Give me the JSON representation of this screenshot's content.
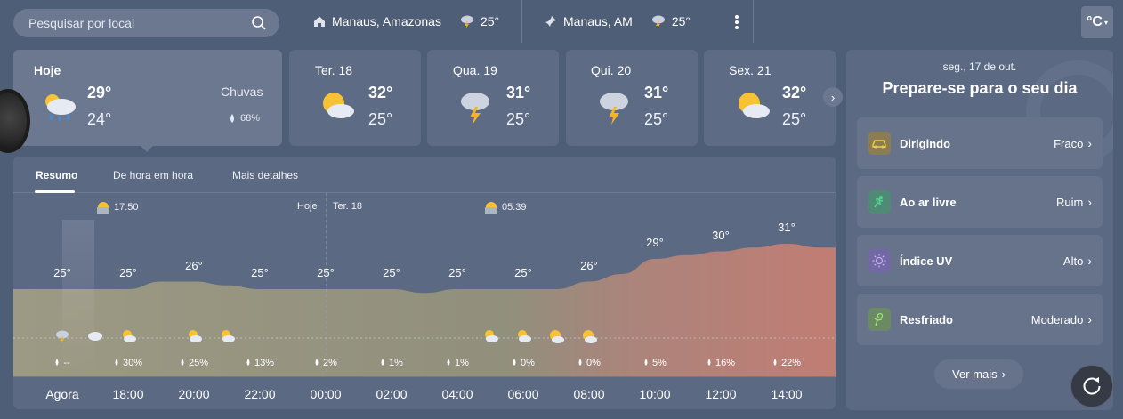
{
  "search": {
    "placeholder": "Pesquisar por local"
  },
  "locations": [
    {
      "name": "Manaus, Amazonas",
      "temp": "25°",
      "icon": "home-icon"
    },
    {
      "name": "Manaus, AM",
      "temp": "25°",
      "icon": "pin-icon"
    }
  ],
  "unit": {
    "label": "°C"
  },
  "forecast": [
    {
      "day": "Hoje",
      "hi": "29°",
      "lo": "24°",
      "icon": "rain-cloud-icon",
      "rain_label": "Chuvas",
      "rain_pct": "68%"
    },
    {
      "day": "Ter. 18",
      "hi": "32°",
      "lo": "25°",
      "icon": "partly-cloudy-icon"
    },
    {
      "day": "Qua. 19",
      "hi": "31°",
      "lo": "25°",
      "icon": "thunderstorm-icon"
    },
    {
      "day": "Qui. 20",
      "hi": "31°",
      "lo": "25°",
      "icon": "thunderstorm-icon"
    },
    {
      "day": "Sex. 21",
      "hi": "32°",
      "lo": "25°",
      "icon": "partly-cloudy-icon"
    }
  ],
  "tabs": [
    "Resumo",
    "De hora em hora",
    "Mais detalhes"
  ],
  "markers": {
    "sunset": "17:50",
    "today": "Hoje",
    "tomorrow": "Ter. 18",
    "sunrise": "05:39"
  },
  "chart_data": {
    "type": "area",
    "x": [
      "Agora",
      "",
      "18:00",
      "",
      "20:00",
      "",
      "22:00",
      "",
      "00:00",
      "",
      "02:00",
      "",
      "04:00",
      "",
      "06:00",
      "",
      "08:00",
      "",
      "10:00",
      "",
      "12:00",
      "",
      "14:00",
      ""
    ],
    "temperature": [
      25,
      25,
      25,
      26,
      26,
      25.5,
      25,
      25,
      25,
      25,
      25,
      24.5,
      25,
      25,
      25,
      25,
      26,
      27,
      29,
      29.5,
      30,
      30.5,
      31,
      30.5
    ],
    "labels": [
      "25°",
      "25°",
      "26°",
      "25°",
      "25°",
      "25°",
      "25°",
      "25°",
      "26°",
      "29°",
      "30°",
      "31°"
    ],
    "times": [
      "Agora",
      "18:00",
      "20:00",
      "22:00",
      "00:00",
      "02:00",
      "04:00",
      "06:00",
      "08:00",
      "10:00",
      "12:00",
      "14:00"
    ],
    "precip": [
      "--",
      "30%",
      "25%",
      "13%",
      "2%",
      "1%",
      "1%",
      "0%",
      "0%",
      "5%",
      "16%",
      "22%"
    ],
    "icons": [
      "thunderstorm-icon",
      "cloud-icon",
      "partly-cloudy-night-icon",
      "",
      "partly-cloudy-night-icon",
      "partly-cloudy-night-icon",
      "",
      "",
      "",
      "",
      "",
      "",
      "",
      "partly-cloudy-night-icon",
      "partly-cloudy-night-icon",
      "partly-cloudy-icon",
      "partly-cloudy-icon"
    ],
    "grid": false
  },
  "prepare": {
    "date": "seg., 17 de out.",
    "title": "Prepare-se para o seu dia",
    "items": [
      {
        "label": "Dirigindo",
        "value": "Fraco",
        "icon": "car-icon",
        "color": "#c9a93b"
      },
      {
        "label": "Ao ar livre",
        "value": "Ruim",
        "icon": "running-icon",
        "color": "#4ec27f"
      },
      {
        "label": "Índice UV",
        "value": "Alto",
        "icon": "sun-icon",
        "color": "#a58bdc"
      },
      {
        "label": "Resfriado",
        "value": "Moderado",
        "icon": "sneeze-icon",
        "color": "#8ed472"
      }
    ],
    "see_more": "Ver mais"
  }
}
